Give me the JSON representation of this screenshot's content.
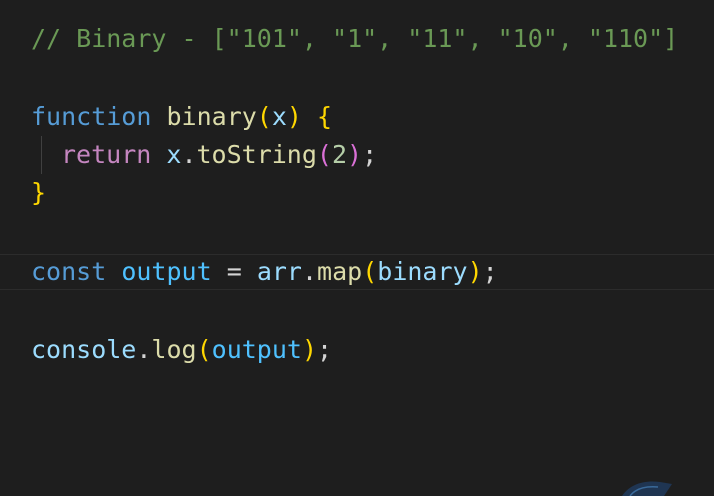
{
  "editor": {
    "line1": {
      "comment": "// Binary - [\"101\", \"1\", \"11\", \"10\", \"110\"]"
    },
    "line3": {
      "keyword": "function",
      "name": "binary",
      "open_paren": "(",
      "param": "x",
      "close_paren": ")",
      "open_brace": "{"
    },
    "line4": {
      "keyword": "return",
      "object": "x",
      "dot": ".",
      "method": "toString",
      "open_paren": "(",
      "arg": "2",
      "close_paren": ")",
      "semicolon": ";"
    },
    "line5": {
      "close_brace": "}"
    },
    "line7": {
      "keyword": "const",
      "name": "output",
      "equals": "=",
      "object": "arr",
      "dot": ".",
      "method": "map",
      "open_paren": "(",
      "arg": "binary",
      "close_paren": ")",
      "semicolon": ";"
    },
    "line9": {
      "object": "console",
      "dot": ".",
      "method": "log",
      "open_paren": "(",
      "arg": "output",
      "close_paren": ")",
      "semicolon": ";"
    }
  },
  "colors": {
    "background": "#1e1e1e",
    "comment": "#6a9955",
    "keyword": "#569cd6",
    "control_keyword": "#c586c0",
    "function": "#dcdcaa",
    "variable": "#9cdcfe",
    "constant": "#4fc1ff",
    "number": "#b5cea8",
    "bracket_level_1": "#ffd700",
    "bracket_level_2": "#da70d6"
  }
}
